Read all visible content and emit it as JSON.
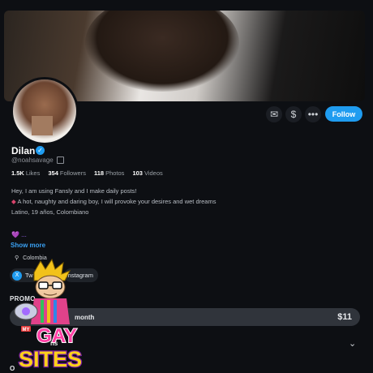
{
  "profile": {
    "name": "Dilan",
    "handle": "@noahsavage",
    "stats": [
      {
        "value": "1.5K",
        "label": "Likes"
      },
      {
        "value": "354",
        "label": "Followers"
      },
      {
        "value": "118",
        "label": "Photos"
      },
      {
        "value": "103",
        "label": "Videos"
      }
    ],
    "bio_line1": "Hey, I am using Fansly and I make daily posts!",
    "bio_line2": "A hot, naughty and daring boy, I will provoke your desires and wet dreams",
    "bio_line3": "Latino, 19 años, Colombiano",
    "heart_line": "💜 ...",
    "show_more": "Show more",
    "location": "Colombia"
  },
  "actions": {
    "follow_label": "Follow",
    "message_icon": "envelope-icon",
    "tip_icon": "dollar-icon",
    "more_icon": "more-icon"
  },
  "socials": {
    "twitter_label": "Tw",
    "instagram_label": "Instagram"
  },
  "promo": {
    "title": "PROMO",
    "period": "month",
    "price": "$11",
    "tiers_label": "ns",
    "other_label": "O"
  },
  "overlay": {
    "line1": "GAY",
    "line2": "SITES",
    "badge": "MY"
  },
  "colors": {
    "accent": "#1f9cf0",
    "background": "#0d0f13",
    "bar": "#30343b"
  }
}
